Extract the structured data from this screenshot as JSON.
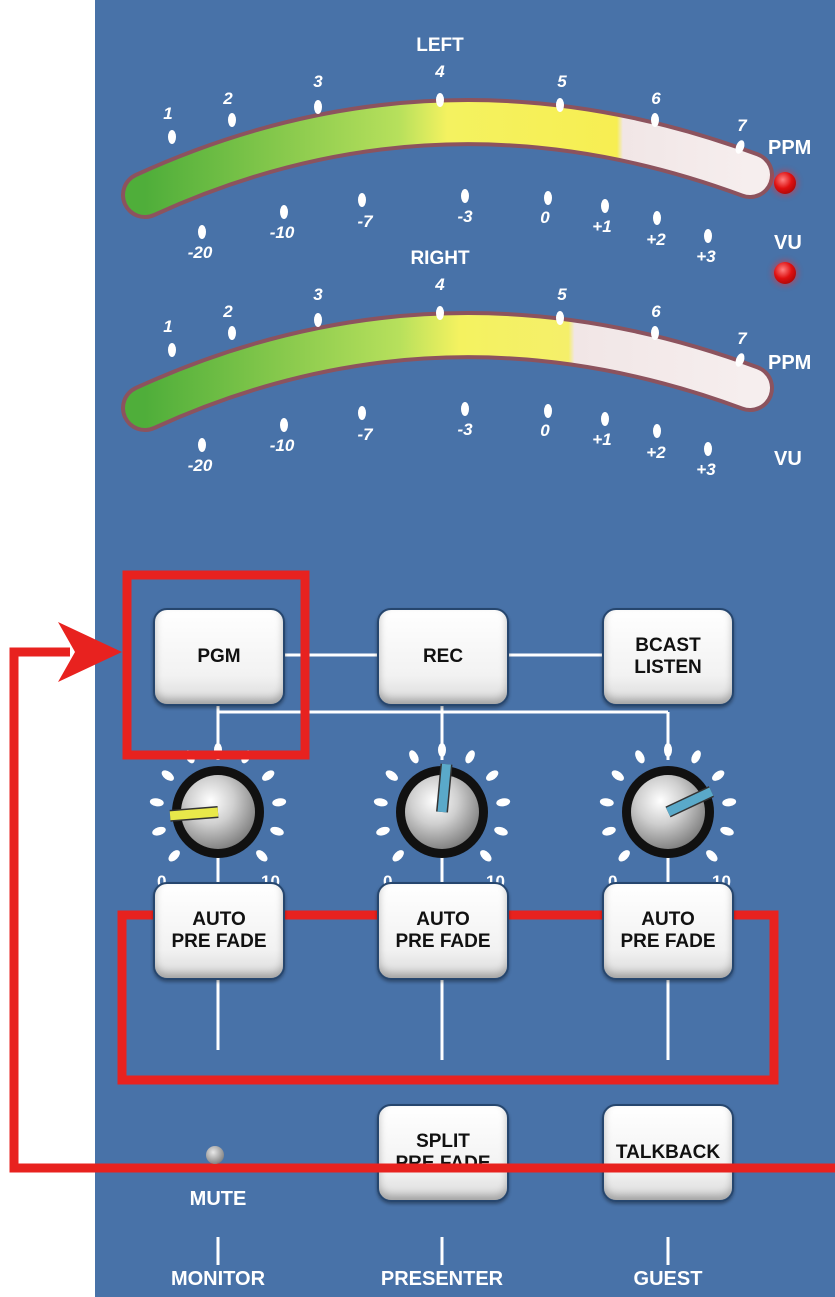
{
  "meters": [
    {
      "title": "LEFT",
      "ppm_label": "PPM",
      "vu_label": "VU",
      "ppm_ticks": [
        "1",
        "2",
        "3",
        "4",
        "5",
        "6",
        "7"
      ],
      "vu_ticks": [
        "-20",
        "-10",
        "-7",
        "-3",
        "0",
        "+1",
        "+2",
        "+3"
      ],
      "ppm_led": "on",
      "vu_led": "on",
      "level_fraction": 0.79
    },
    {
      "title": "RIGHT",
      "ppm_label": "PPM",
      "vu_label": "VU",
      "ppm_ticks": [
        "1",
        "2",
        "3",
        "4",
        "5",
        "6",
        "7"
      ],
      "vu_ticks": [
        "-20",
        "-10",
        "-7",
        "-3",
        "0",
        "+1",
        "+2",
        "+3"
      ],
      "level_fraction": 0.71
    }
  ],
  "buttons": {
    "pgm": "PGM",
    "rec": "REC",
    "bcast": "BCAST\nLISTEN",
    "auto_monitor": "AUTO\nPRE FADE",
    "auto_presenter": "AUTO\nPRE FADE",
    "auto_guest": "AUTO\nPRE FADE",
    "split": "SPLIT\nPRE FADE",
    "talkback": "TALKBACK"
  },
  "knobs": [
    {
      "channel": "monitor",
      "min_label": "0",
      "max_label": "10",
      "pointer_color": "#e8e84a",
      "value": 1.5
    },
    {
      "channel": "presenter",
      "min_label": "0",
      "max_label": "10",
      "pointer_color": "#5aa9c9",
      "value": 5.2
    },
    {
      "channel": "guest",
      "min_label": "0",
      "max_label": "10",
      "pointer_color": "#5aa9c9",
      "value": 7.4
    }
  ],
  "mute_label": "MUTE",
  "channels": [
    "MONITOR",
    "PRESENTER",
    "GUEST"
  ],
  "colors": {
    "panel": "#4872a8",
    "highlight": "#e8221f",
    "meter_green": "#7ccf4a",
    "meter_yellow": "#f4f260",
    "meter_white": "#f1e6e6"
  }
}
